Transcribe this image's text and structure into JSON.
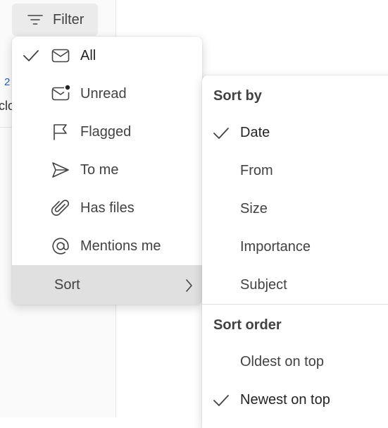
{
  "background": {
    "count_fragment": "2",
    "text_fragment": "clo"
  },
  "filter_button": {
    "label": "Filter",
    "icon": "filter-lines-icon"
  },
  "filter_menu": {
    "items": [
      {
        "label": "All",
        "icon": "envelope-icon",
        "checked": true
      },
      {
        "label": "Unread",
        "icon": "envelope-dot-icon",
        "checked": false
      },
      {
        "label": "Flagged",
        "icon": "flag-icon",
        "checked": false
      },
      {
        "label": "To me",
        "icon": "send-icon",
        "checked": false
      },
      {
        "label": "Has files",
        "icon": "paperclip-icon",
        "checked": false
      },
      {
        "label": "Mentions me",
        "icon": "at-sign-icon",
        "checked": false
      }
    ],
    "sort_label": "Sort"
  },
  "sort_submenu": {
    "sort_by_header": "Sort by",
    "sort_by": [
      {
        "label": "Date",
        "checked": true
      },
      {
        "label": "From",
        "checked": false
      },
      {
        "label": "Size",
        "checked": false
      },
      {
        "label": "Importance",
        "checked": false
      },
      {
        "label": "Subject",
        "checked": false
      }
    ],
    "sort_order_header": "Sort order",
    "sort_order": [
      {
        "label": "Oldest on top",
        "checked": false
      },
      {
        "label": "Newest on top",
        "checked": true
      }
    ]
  },
  "colors": {
    "accent_link": "#2b63b7",
    "hover_bg": "#e0e0e0",
    "button_bg": "#ebebeb"
  }
}
